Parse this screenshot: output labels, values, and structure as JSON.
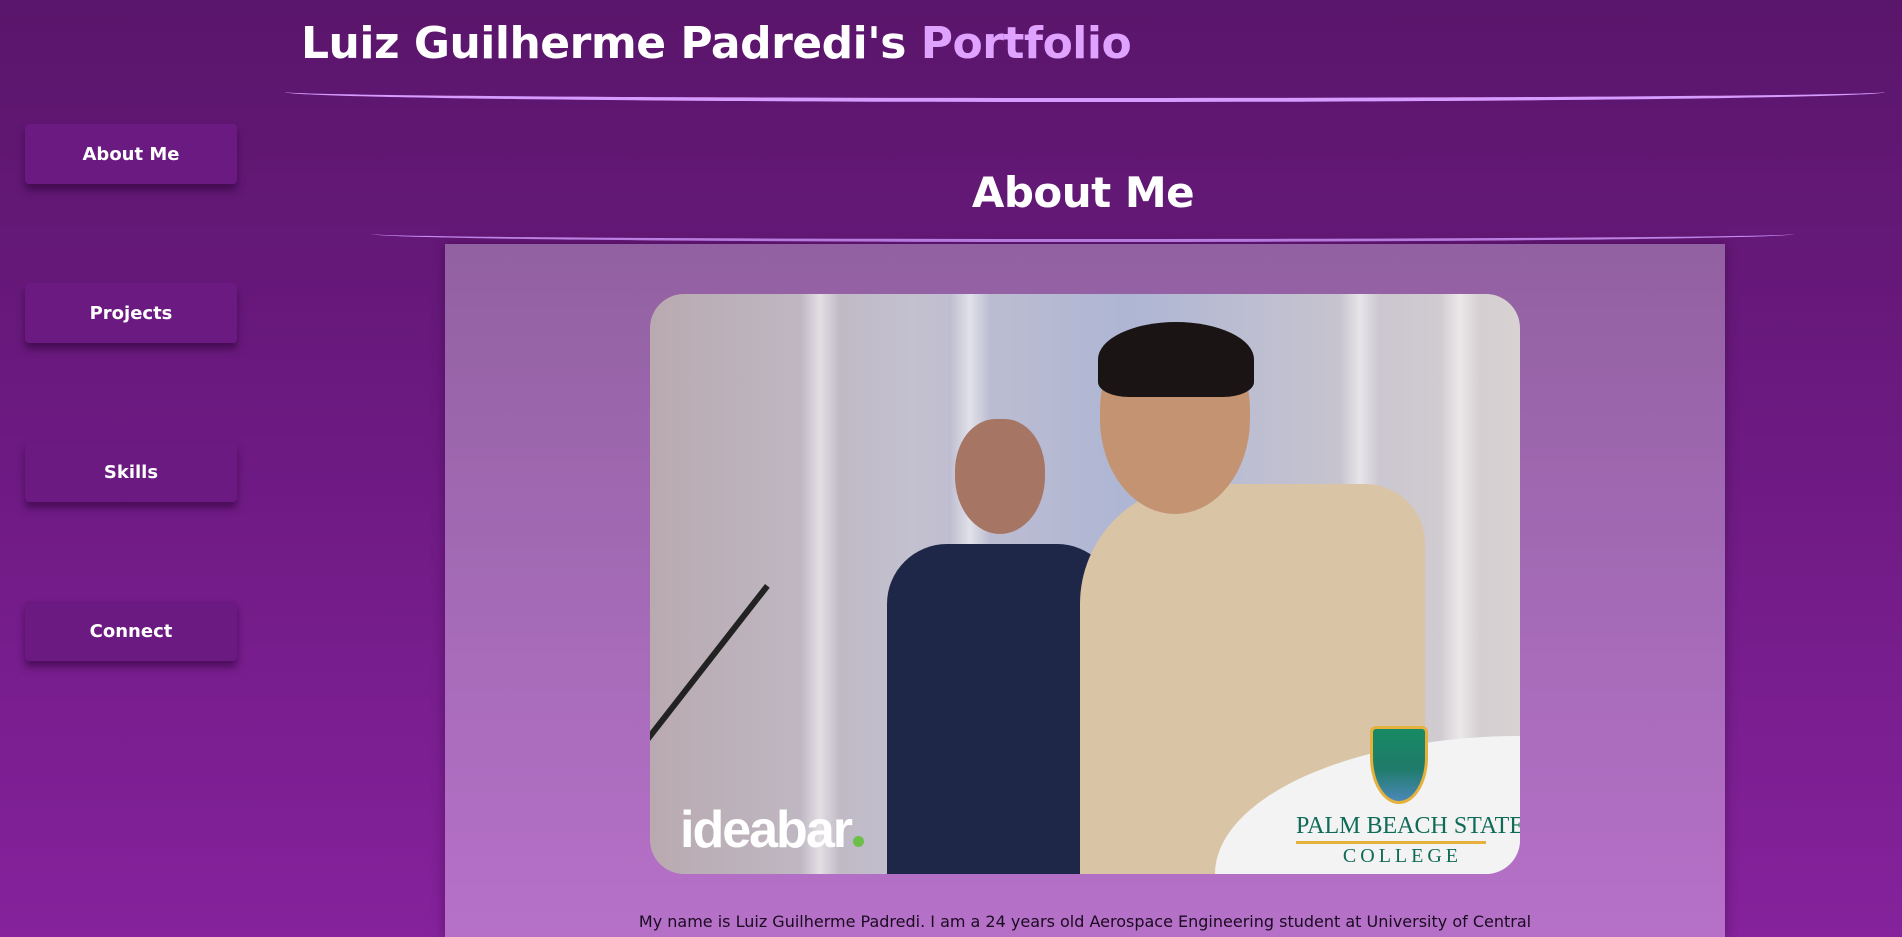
{
  "header": {
    "title_main": "Luiz Guilherme Padredi's",
    "title_accent": "Portfolio"
  },
  "sidebar": {
    "items": [
      {
        "label": "About Me"
      },
      {
        "label": "Projects"
      },
      {
        "label": "Skills"
      },
      {
        "label": "Connect"
      }
    ]
  },
  "main": {
    "section_title": "About Me",
    "photo": {
      "logo_left": "ideabar",
      "college_line1": "PALM BEACH STATE",
      "college_line2": "COLLEGE"
    },
    "bio": "My name is Luiz Guilherme Padredi. I am a 24 years old Aerospace Engineering student at University of Central"
  },
  "colors": {
    "background": "#6e1a83",
    "accent": "#e0a2ff",
    "panel": "#a66bb8",
    "nav_button": "#6a1a80"
  }
}
